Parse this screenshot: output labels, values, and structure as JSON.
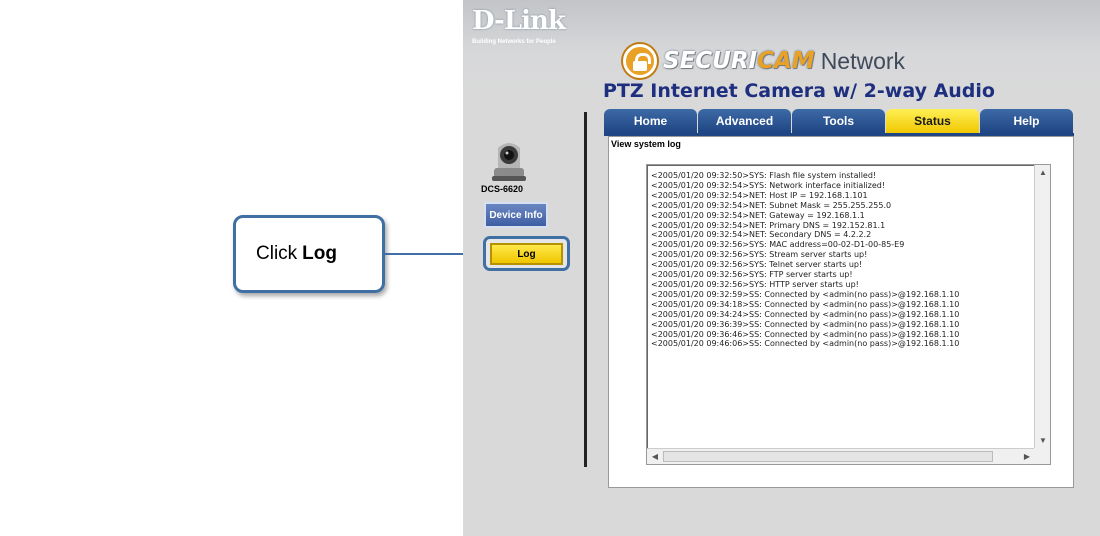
{
  "callout": {
    "prefix": "Click",
    "emphasis": "Log"
  },
  "branding": {
    "brand": "D-Link",
    "tagline": "Building Networks for People",
    "product_securi": "SECURI",
    "product_cam": "CAM",
    "product_network": "Network",
    "product_subtitle": "PTZ Internet Camera w/ 2-way Audio",
    "accent_color": "#e9a126",
    "tab_blue": "#1f4583",
    "tab_active": "#f0c800"
  },
  "sidebar": {
    "model": "DCS-6620",
    "device_info_label": "Device Info",
    "log_label": "Log"
  },
  "tabs": [
    {
      "label": "Home",
      "active": false
    },
    {
      "label": "Advanced",
      "active": false
    },
    {
      "label": "Tools",
      "active": false
    },
    {
      "label": "Status",
      "active": true
    },
    {
      "label": "Help",
      "active": false
    }
  ],
  "content": {
    "title": "View system log",
    "log_lines": [
      "<2005/01/20 09:32:50>SYS: Flash file system installed!",
      "<2005/01/20 09:32:54>SYS: Network interface initialized!",
      "<2005/01/20 09:32:54>NET: Host IP = 192.168.1.101",
      "<2005/01/20 09:32:54>NET: Subnet Mask = 255.255.255.0",
      "<2005/01/20 09:32:54>NET: Gateway = 192.168.1.1",
      "<2005/01/20 09:32:54>NET: Primary DNS = 192.152.81.1",
      "<2005/01/20 09:32:54>NET: Secondary DNS = 4.2.2.2",
      "<2005/01/20 09:32:56>SYS: MAC address=00-02-D1-00-85-E9",
      "<2005/01/20 09:32:56>SYS: Stream server starts up!",
      "<2005/01/20 09:32:56>SYS: Telnet server starts up!",
      "<2005/01/20 09:32:56>SYS: FTP server starts up!",
      "<2005/01/20 09:32:56>SYS: HTTP server starts up!",
      "<2005/01/20 09:32:59>SS: Connected by <admin(no pass)>@192.168.1.10",
      "<2005/01/20 09:34:18>SS: Connected by <admin(no pass)>@192.168.1.10",
      "<2005/01/20 09:34:24>SS: Connected by <admin(no pass)>@192.168.1.10",
      "<2005/01/20 09:36:39>SS: Connected by <admin(no pass)>@192.168.1.10",
      "<2005/01/20 09:36:46>SS: Connected by <admin(no pass)>@192.168.1.10",
      "<2005/01/20 09:46:06>SS: Connected by <admin(no pass)>@192.168.1.10"
    ]
  }
}
